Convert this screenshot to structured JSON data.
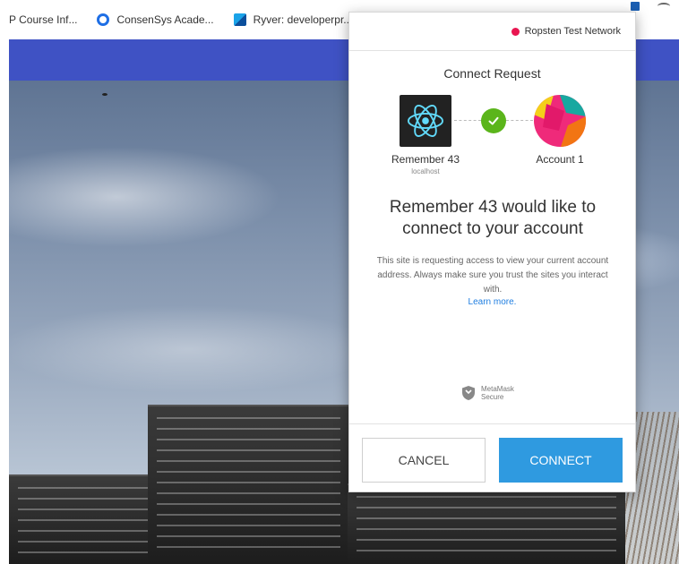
{
  "bookmarks": [
    {
      "label": "P Course Inf...",
      "icon": "none"
    },
    {
      "label": "ConsenSys Acade...",
      "icon": "consensys-icon"
    },
    {
      "label": "Ryver: developerpr...",
      "icon": "ryver-icon"
    }
  ],
  "colors": {
    "site_header": "#3f52c4",
    "network_dot": "#e91550",
    "connect_button": "#2f9ae0",
    "check": "#5bb51b",
    "learn_link": "#1f7ee0"
  },
  "popup": {
    "network": "Ropsten Test Network",
    "title": "Connect Request",
    "site": {
      "name": "Remember 43",
      "host": "localhost",
      "icon": "react-logo-icon"
    },
    "account": {
      "name": "Account 1",
      "icon": "jazzicon-avatar"
    },
    "headline": "Remember 43 would like to connect to your account",
    "description": "This site is requesting access to view your current account address. Always make sure you trust the sites you interact with.",
    "learn_more": "Learn more.",
    "secure_line1": "MetaMask",
    "secure_line2": "Secure",
    "cancel_label": "CANCEL",
    "connect_label": "CONNECT"
  }
}
